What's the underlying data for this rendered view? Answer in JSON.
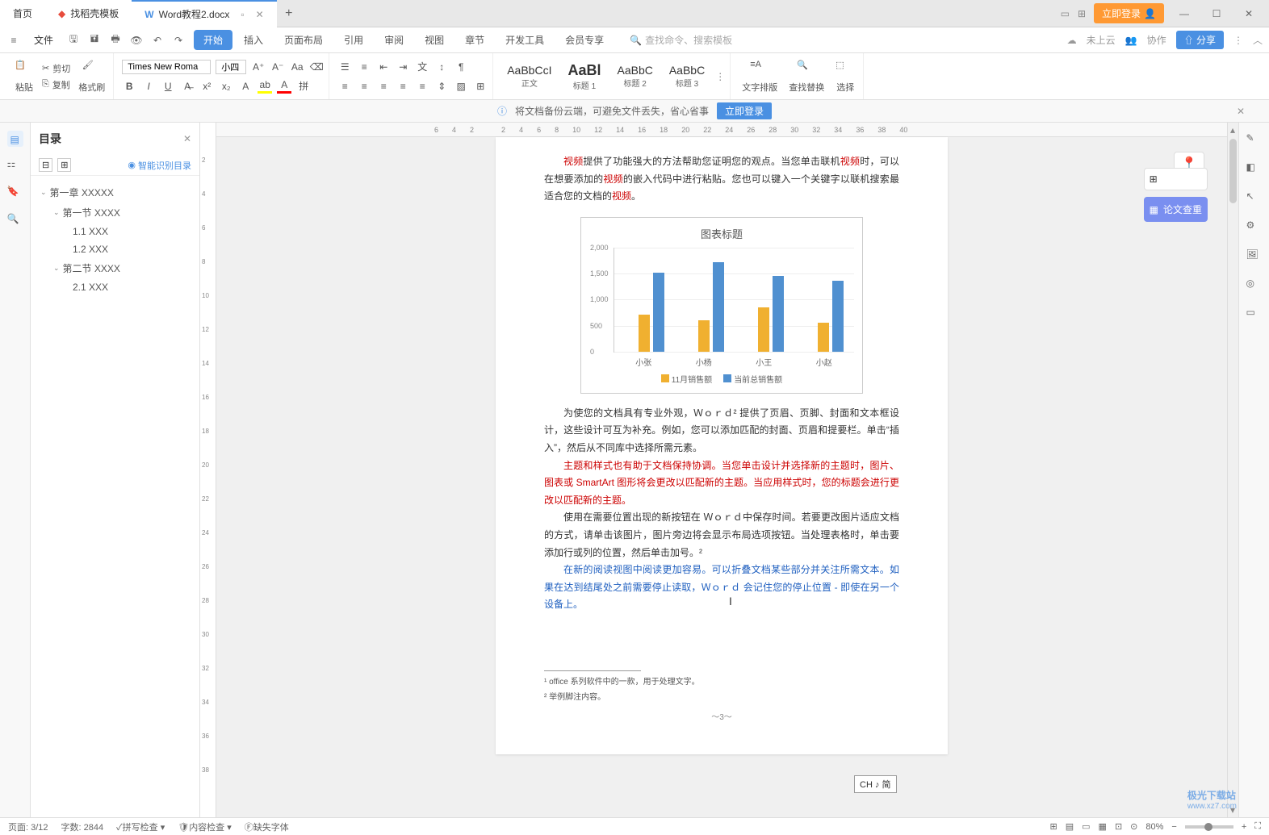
{
  "tabs": {
    "home": "首页",
    "template": "找稻壳模板",
    "doc": "Word教程2.docx"
  },
  "top_right": {
    "login": "立即登录"
  },
  "menu": {
    "file": "文件",
    "tabs": [
      "开始",
      "插入",
      "页面布局",
      "引用",
      "审阅",
      "视图",
      "章节",
      "开发工具",
      "会员专享"
    ],
    "search_placeholder": "查找命令、搜索模板",
    "cloud_status": "未上云",
    "collab": "协作",
    "share": "分享"
  },
  "ribbon": {
    "paste": "粘贴",
    "cut": "剪切",
    "copy": "复制",
    "format_painter": "格式刷",
    "font_name": "Times New Roma",
    "font_size": "小四",
    "style_preview1": "AaBbCcI",
    "style_label1": "正文",
    "style_preview2": "AaBl",
    "style_label2": "标题 1",
    "style_preview3": "AaBbC",
    "style_label3": "标题 2",
    "style_preview4": "AaBbC",
    "style_label4": "标题 3",
    "text_layout": "文字排版",
    "find_replace": "查找替换",
    "select": "选择"
  },
  "banner": {
    "text": "将文档备份云端，可避免文件丢失，省心省事",
    "action": "立即登录"
  },
  "outline": {
    "title": "目录",
    "smart": "智能识别目录",
    "items": [
      {
        "level": 1,
        "text": "第一章  XXXXX",
        "expanded": true
      },
      {
        "level": 2,
        "text": "第一节  XXXX",
        "expanded": true
      },
      {
        "level": 3,
        "text": "1.1 XXX"
      },
      {
        "level": 3,
        "text": "1.2 XXX"
      },
      {
        "level": 2,
        "text": "第二节  XXXX",
        "expanded": true
      },
      {
        "level": 3,
        "text": "2.1 XXX"
      }
    ]
  },
  "ruler_h": [
    "6",
    "4",
    "2",
    "",
    "2",
    "4",
    "6",
    "8",
    "10",
    "12",
    "14",
    "16",
    "18",
    "20",
    "22",
    "24",
    "26",
    "28",
    "30",
    "32",
    "34",
    "36",
    "38",
    "40"
  ],
  "ruler_v": [
    "",
    "2",
    "4",
    "6",
    "8",
    "10",
    "12",
    "14",
    "16",
    "18",
    "20",
    "22",
    "24",
    "26",
    "28",
    "30",
    "32",
    "34",
    "36",
    "38"
  ],
  "doc": {
    "p1_a": "提供了功能强大的方法帮助您证明您的观点。当您单击联机",
    "p1_b": "时，可以在想要添加的",
    "p1_c": "的嵌入代码中进行粘贴。您也可以键入一个关键字以联机搜索最适合您的文档的",
    "p1_video": "视频",
    "p2": "为使您的文档具有专业外观，Ｗｏｒｄ² 提供了页眉、页脚、封面和文本框设计，这些设计可互为补充。例如，您可以添加匹配的封面、页眉和提要栏。单击“插入”，然后从不同库中选择所需元素。",
    "p3": "主题和样式也有助于文档保持协调。当您单击设计并选择新的主题时，图片、图表或 SmartArt 图形将会更改以匹配新的主题。当应用样式时，您的标题会进行更改以匹配新的主题。",
    "p4": "使用在需要位置出现的新按钮在 Ｗｏｒｄ中保存时间。若要更改图片适应文档的方式，请单击该图片，图片旁边将会显示布局选项按钮。当处理表格时，单击要添加行或列的位置，然后单击加号。²",
    "p5": "在新的阅读视图中阅读更加容易。可以折叠文档某些部分并关注所需文本。如果在达到结尾处之前需要停止读取，Ｗｏｒｄ 会记住您的停止位置 - 即使在另一个设备上。",
    "footnote1": "¹  office 系列软件中的一款，用于处理文字。",
    "footnote2": "²  举例脚注内容。",
    "page_num": "～3～"
  },
  "chart_data": {
    "type": "bar",
    "title": "图表标题",
    "categories": [
      "小张",
      "小杨",
      "小王",
      "小赵"
    ],
    "series": [
      {
        "name": "11月销售额",
        "values": [
          700,
          600,
          850,
          550
        ],
        "color": "#f0b030"
      },
      {
        "name": "当前总销售额",
        "values": [
          1500,
          1700,
          1450,
          1350
        ],
        "color": "#5090d0"
      }
    ],
    "xlabel": "",
    "ylabel": "",
    "ylim": [
      0,
      2000
    ],
    "y_ticks": [
      0,
      500,
      1000,
      1500,
      2000
    ]
  },
  "right_panel": {
    "thesis_check": "论文查重"
  },
  "ime": "CH ♪ 简",
  "status": {
    "page": "页面: 3/12",
    "words": "字数: 2844",
    "spell": "拼写检查",
    "content": "内容检查",
    "missing_font": "缺失字体",
    "zoom": "80%"
  },
  "watermark": {
    "brand": "极光下载站",
    "url": "www.xz7.com"
  }
}
